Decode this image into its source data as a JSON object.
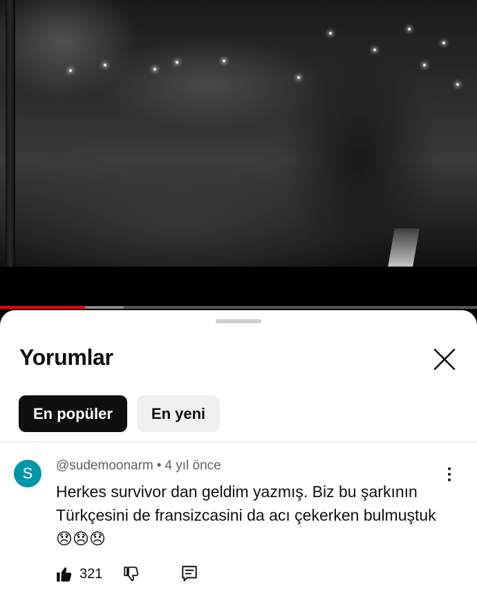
{
  "video": {
    "progress_played_fraction": 0.178,
    "progress_buffered_fraction": 0.26
  },
  "comments_panel": {
    "title": "Yorumlar",
    "close_icon": "close-icon",
    "chips": [
      {
        "label": "En popüler",
        "active": true
      },
      {
        "label": "En yeni",
        "active": false
      }
    ]
  },
  "comments": [
    {
      "avatar_letter": "S",
      "avatar_color": "#0096a8",
      "author": "@sudemoonarm",
      "separator": "•",
      "time": "4 yıl önce",
      "text": "Herkes survivor dan geldim yazmış. Biz bu şarkının Türkçesini de fransizcasini da acı çekerken bulmuştuk 😞😞😞",
      "like_count": "321",
      "icons": [
        "like-icon",
        "dislike-icon",
        "reply-icon",
        "more-vert-icon"
      ]
    }
  ],
  "colors": {
    "accent_red": "#ff0000",
    "text_primary": "#0f0f0f",
    "text_secondary": "#606060"
  }
}
